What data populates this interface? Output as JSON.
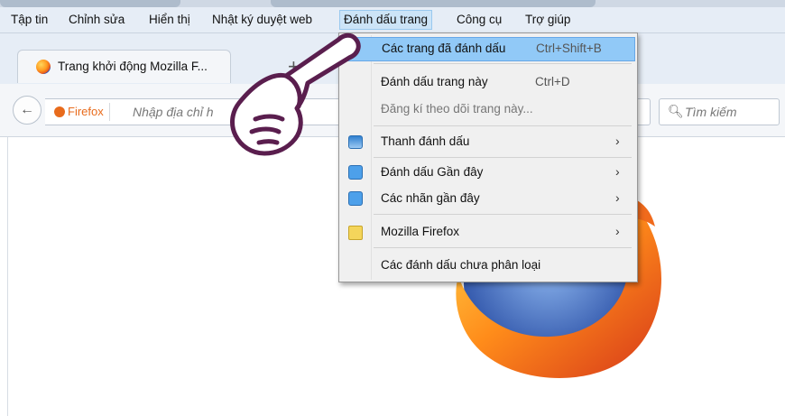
{
  "menubar": {
    "items": [
      {
        "label": "Tập tin"
      },
      {
        "label": "Chỉnh sửa"
      },
      {
        "label": "Hiển thị"
      },
      {
        "label": "Nhật ký duyệt web"
      },
      {
        "label": "Đánh dấu trang"
      },
      {
        "label": "Công cụ"
      },
      {
        "label": "Trợ giúp"
      }
    ]
  },
  "tabs": [
    {
      "title": "Trang khởi động Mozilla F..."
    }
  ],
  "newtab_label": "+",
  "navbar": {
    "back_icon": "back-arrow-icon",
    "identity_label": "Firefox",
    "url_placeholder": "Nhập địa chỉ h",
    "search_placeholder": "Tìm kiếm"
  },
  "bookmarks_menu": {
    "items": [
      {
        "label": "Các trang đã đánh dấu",
        "shortcut": "Ctrl+Shift+B"
      },
      {
        "label": "Đánh dấu trang này",
        "shortcut": "Ctrl+D"
      },
      {
        "label": "Đăng kí theo dõi trang này..."
      },
      {
        "label": "Thanh đánh dấu",
        "icon": "bookmarks-toolbar-icon"
      },
      {
        "label": "Đánh dấu Gần đây",
        "icon": "smart-folder-icon"
      },
      {
        "label": "Các nhãn gần đây",
        "icon": "smart-folder-icon"
      },
      {
        "label": "Mozilla Firefox",
        "icon": "folder-icon"
      },
      {
        "label": "Các đánh dấu chưa phân loại"
      }
    ],
    "submenu_arrow": "›"
  },
  "colors": {
    "menubar_bg": "#e6edf6",
    "menu_highlight": "#91c9f7",
    "firefox_orange": "#e86b1c",
    "hand_outline": "#5a1e4e"
  }
}
